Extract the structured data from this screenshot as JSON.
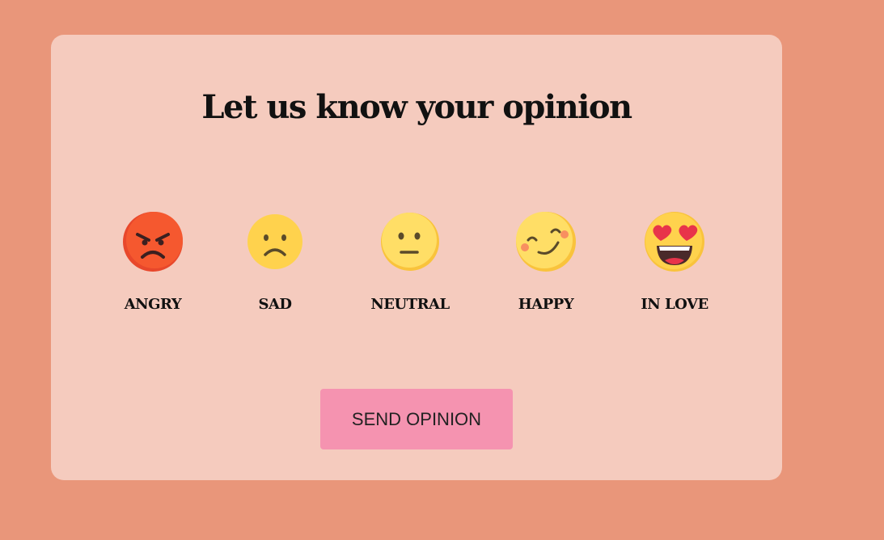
{
  "card": {
    "title": "Let us know your opinion"
  },
  "moods": [
    {
      "label": "ANGRY",
      "icon": "angry-face-icon"
    },
    {
      "label": "SAD",
      "icon": "sad-face-icon"
    },
    {
      "label": "NEUTRAL",
      "icon": "neutral-face-icon"
    },
    {
      "label": "HAPPY",
      "icon": "happy-face-icon"
    },
    {
      "label": "IN LOVE",
      "icon": "heart-eyes-face-icon"
    }
  ],
  "send_button": {
    "label": "SEND OPINION"
  },
  "colors": {
    "page_background": "#e9967a",
    "card_background": "#f5cbbe",
    "button_background": "#f593b0"
  }
}
